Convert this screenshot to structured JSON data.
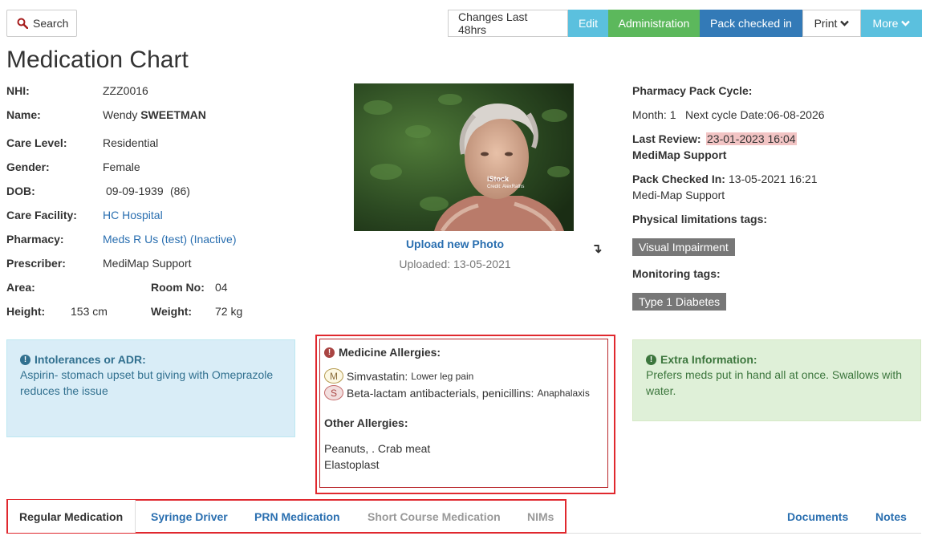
{
  "toolbar": {
    "search_label": "Search",
    "changes_label": "Changes Last 48hrs",
    "edit_label": "Edit",
    "admin_label": "Administration",
    "pack_label": "Pack checked in",
    "print_label": "Print",
    "more_label": "More"
  },
  "page_title": "Medication Chart",
  "patient": {
    "nhi_label": "NHI:",
    "nhi": "ZZZ0016",
    "name_label": "Name:",
    "first_name": "Wendy",
    "last_name": "SWEETMAN",
    "care_level_label": "Care Level:",
    "care_level": "Residential",
    "gender_label": "Gender:",
    "gender": "Female",
    "dob_label": "DOB:",
    "dob": "09-09-1939",
    "age": "(86)",
    "facility_label": "Care Facility:",
    "facility": "HC Hospital",
    "pharmacy_label": "Pharmacy:",
    "pharmacy": "Meds R Us (test) (Inactive)",
    "prescriber_label": "Prescriber:",
    "prescriber": "MediMap Support",
    "area_label": "Area:",
    "area": "",
    "room_label": "Room No:",
    "room": "04",
    "height_label": "Height:",
    "height": "153 cm",
    "weight_label": "Weight:",
    "weight": "72 kg"
  },
  "photo": {
    "watermark": "iStock",
    "credit": "Credit: AlexRaths",
    "upload_label": "Upload new Photo",
    "uploaded_text": "Uploaded: 13-05-2021"
  },
  "pharmacy_info": {
    "cycle_label": "Pharmacy Pack Cycle:",
    "month_text": "Month: 1",
    "next_cycle_text": "Next cycle Date:06-08-2026",
    "last_review_label": "Last Review:",
    "last_review_value": "23-01-2023 16:04",
    "last_review_by": "MediMap Support",
    "pack_checked_label": "Pack Checked In:",
    "pack_checked_value": "13-05-2021 16:21",
    "pack_checked_by": "Medi-Map Support",
    "physical_tags_label": "Physical limitations tags:",
    "physical_tags": [
      "Visual Impairment"
    ],
    "monitoring_tags_label": "Monitoring tags:",
    "monitoring_tags": [
      "Type 1 Diabetes"
    ]
  },
  "intolerances": {
    "title": "Intolerances or ADR:",
    "text": "Aspirin- stomach upset but giving with Omeprazole reduces the issue"
  },
  "allergies": {
    "title": "Medicine Allergies:",
    "items": [
      {
        "badge": "M",
        "name": "Simvastatin:",
        "reaction": "Lower leg pain"
      },
      {
        "badge": "S",
        "name": "Beta-lactam antibacterials, penicillins:",
        "reaction": "Anaphalaxis"
      }
    ],
    "other_title": "Other Allergies:",
    "other_lines": [
      "Peanuts, . Crab meat",
      "Elastoplast"
    ]
  },
  "extra_info": {
    "title": "Extra Information:",
    "text": "Prefers meds put in hand all at once. Swallows with water."
  },
  "tabs": {
    "regular": "Regular Medication",
    "syringe": "Syringe Driver",
    "prn": "PRN Medication",
    "short_course": "Short Course Medication",
    "nims": "NIMs",
    "documents": "Documents",
    "notes": "Notes"
  },
  "colors": {
    "link": "#2a6fb0",
    "edit": "#5bc0de",
    "admin": "#5cb85c",
    "pack": "#337ab7",
    "highlight_red": "#e0282e"
  }
}
